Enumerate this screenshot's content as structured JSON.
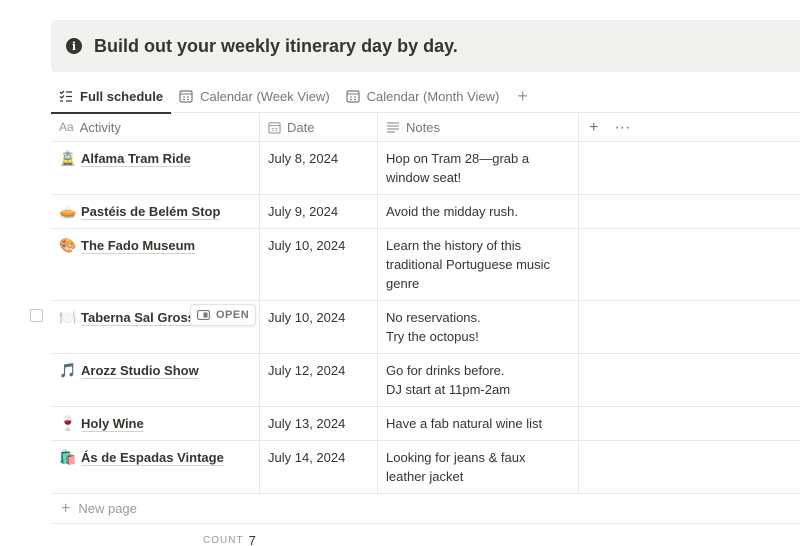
{
  "callout": {
    "icon": "info-icon",
    "text": "Build out your weekly itinerary day by day."
  },
  "tabs": [
    {
      "label": "Full schedule",
      "icon": "checklist-icon",
      "active": true
    },
    {
      "label": "Calendar (Week View)",
      "icon": "calendar-icon",
      "active": false
    },
    {
      "label": "Calendar (Month View)",
      "icon": "calendar-icon",
      "active": false
    }
  ],
  "table": {
    "headers": {
      "activity": "Activity",
      "date": "Date",
      "notes": "Notes",
      "activity_icon_text": "Aa"
    },
    "rows": [
      {
        "emoji": "🚊",
        "activity": "Alfama Tram Ride",
        "date": "July 8, 2024",
        "notes": [
          "Hop on Tram 28—grab a",
          "window seat!"
        ]
      },
      {
        "emoji": "🥧",
        "activity": "Pastéis de Belém Stop",
        "date": "July 9, 2024",
        "notes": [
          "Avoid the midday rush."
        ]
      },
      {
        "emoji": "🎨",
        "activity": "The Fado Museum",
        "date": "July 10, 2024",
        "notes": [
          "Learn the history of this",
          "traditional Portuguese music",
          "genre"
        ]
      },
      {
        "emoji": "🍽️",
        "activity": "Taberna Sal Grosso",
        "date": "July 10, 2024",
        "notes": [
          "No reservations.",
          "Try the octopus!"
        ],
        "hovered": true
      },
      {
        "emoji": "🎵",
        "activity": "Arozz Studio Show",
        "date": "July 12, 2024",
        "notes": [
          "Go for drinks before.",
          "DJ start at 11pm-2am"
        ]
      },
      {
        "emoji": "🍷",
        "activity": "Holy Wine",
        "date": "July 13, 2024",
        "notes": [
          "Have a fab natural wine list"
        ]
      },
      {
        "emoji": "🛍️",
        "activity": "Ás de Espadas Vintage",
        "date": "July 14, 2024",
        "notes": [
          "Looking for jeans & faux",
          "leather jacket"
        ]
      }
    ],
    "open_label": "OPEN",
    "new_page_label": "New page",
    "count_label": "COUNT",
    "count_value": "7"
  }
}
